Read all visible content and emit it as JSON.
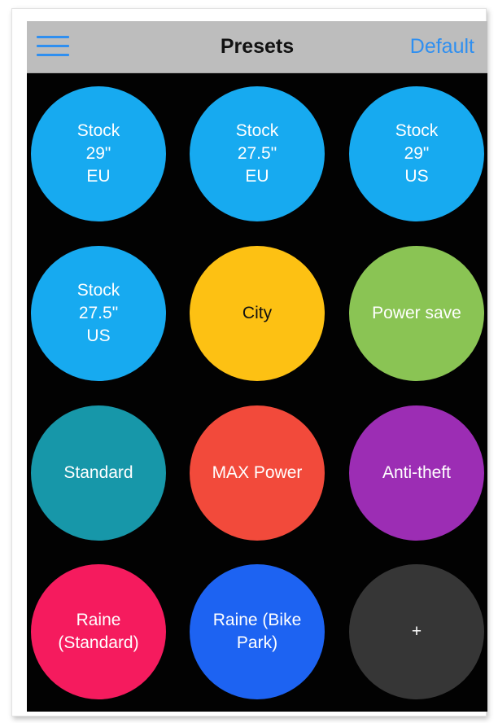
{
  "navbar": {
    "menu_icon": "hamburger-menu-icon",
    "title": "Presets",
    "default_label": "Default",
    "accent_color": "#2f8ff0",
    "background_color": "#bdbdbd"
  },
  "presets": [
    {
      "label": "Stock\n29\"\nEU",
      "color": "#17aaf0"
    },
    {
      "label": "Stock\n27.5\"\nEU",
      "color": "#17aaf0"
    },
    {
      "label": "Stock\n29\"\nUS",
      "color": "#17aaf0"
    },
    {
      "label": "Stock\n27.5\"\nUS",
      "color": "#17aaf0"
    },
    {
      "label": "City",
      "color": "#fdc113",
      "text_color": "#111111"
    },
    {
      "label": "Power save",
      "color": "#8ac454"
    },
    {
      "label": "Standard",
      "color": "#1797a9"
    },
    {
      "label": "MAX Power",
      "color": "#f24a3b"
    },
    {
      "label": "Anti-theft",
      "color": "#9c2db4"
    },
    {
      "label": "Raine\n(Standard)",
      "color": "#f51b5e"
    },
    {
      "label": "Raine (Bike\nPark)",
      "color": "#1d63f2"
    },
    {
      "label": "+",
      "color": "#363636"
    }
  ]
}
